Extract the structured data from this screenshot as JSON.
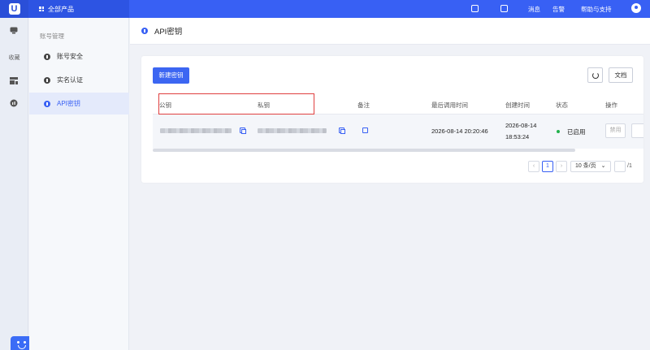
{
  "topbar": {
    "logo": "U",
    "all_products": "全部产品",
    "links": [
      "消息",
      "告警",
      "帮助与支持"
    ]
  },
  "rail": {
    "favorites_label": "收藏"
  },
  "sidebar": {
    "section_title": "账号管理",
    "items": [
      {
        "label": "账号安全"
      },
      {
        "label": "实名认证"
      },
      {
        "label": "API密钥"
      }
    ]
  },
  "page": {
    "title": "API密钥"
  },
  "toolbar": {
    "create_label": "新建密钥",
    "doc_label": "文档"
  },
  "table": {
    "columns": [
      "公钥",
      "私钥",
      "备注",
      "最后调用时间",
      "创建时间",
      "状态",
      "操作"
    ],
    "rows": [
      {
        "last_call": "2026-08-14 20:20:46",
        "created_date": "2026-08-14",
        "created_time": "18:53:24",
        "status": "已启用",
        "action": "禁用"
      }
    ]
  },
  "pagination": {
    "prev": "‹",
    "current_page": "1",
    "next": "›",
    "page_size": "10 条/页",
    "total": "/1"
  },
  "colors": {
    "accent": "#3860f4",
    "highlight": "#e04040",
    "status_on": "#22b14c"
  }
}
